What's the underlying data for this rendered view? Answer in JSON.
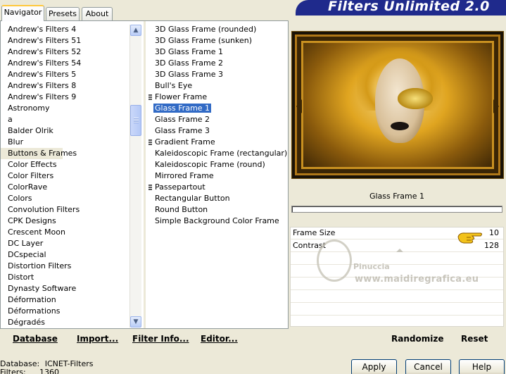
{
  "tabs": [
    {
      "label": "Navigator"
    },
    {
      "label": "Presets"
    },
    {
      "label": "About"
    }
  ],
  "banner": {
    "title": "Filters Unlimited 2.0",
    "color": "#1f2a8c"
  },
  "categories": [
    "Andrew's Filters 4",
    "Andrew's Filters 51",
    "Andrew's Filters 52",
    "Andrew's Filters 54",
    "Andrew's Filters 5",
    "Andrew's Filters 8",
    "Andrew's Filters 9",
    "Astronomy",
    "a",
    "Balder Olrik",
    "Blur",
    "Buttons & Frames",
    "Color Effects",
    "Color Filters",
    "ColorRave",
    "Colors",
    "Convolution Filters",
    "CPK Designs",
    "Crescent Moon",
    "DC Layer",
    "DCspecial",
    "Distortion Filters",
    "Distort",
    "Dynasty Software",
    "Déformation",
    "Déformations",
    "Dégradés"
  ],
  "selected_category": "Buttons & Frames",
  "filters": [
    {
      "label": "3D Glass Frame (rounded)",
      "mark": false
    },
    {
      "label": "3D Glass Frame (sunken)",
      "mark": false
    },
    {
      "label": "3D Glass Frame 1",
      "mark": false
    },
    {
      "label": "3D Glass Frame 2",
      "mark": false
    },
    {
      "label": "3D Glass Frame 3",
      "mark": false
    },
    {
      "label": "Bull's Eye",
      "mark": false
    },
    {
      "label": "Flower Frame",
      "mark": true
    },
    {
      "label": "Glass Frame 1",
      "mark": false
    },
    {
      "label": "Glass Frame 2",
      "mark": false
    },
    {
      "label": "Glass Frame 3",
      "mark": false
    },
    {
      "label": "Gradient Frame",
      "mark": true
    },
    {
      "label": "Kaleidoscopic Frame (rectangular)",
      "mark": false
    },
    {
      "label": "Kaleidoscopic Frame (round)",
      "mark": false
    },
    {
      "label": "Mirrored Frame",
      "mark": false
    },
    {
      "label": "Passepartout",
      "mark": true
    },
    {
      "label": "Rectangular Button",
      "mark": false
    },
    {
      "label": "Round Button",
      "mark": false
    },
    {
      "label": "Simple Background Color Frame",
      "mark": false
    }
  ],
  "selected_filter": "Glass Frame 1",
  "left_buttons": {
    "database": "Database",
    "import": "Import...",
    "filter_info": "Filter Info...",
    "editor": "Editor..."
  },
  "filter_name": "Glass Frame 1",
  "params": [
    {
      "label": "Frame Size",
      "value": "10"
    },
    {
      "label": "Contrast",
      "value": "128"
    }
  ],
  "watermark": {
    "line1": "Pinuccia",
    "line2": "www.maidiregrafica.eu"
  },
  "right_buttons": {
    "randomize": "Randomize",
    "reset": "Reset"
  },
  "status": {
    "database_label": "Database:",
    "database_value": "ICNET-Filters",
    "filters_label": "Filters:",
    "filters_value": "1360"
  },
  "dialog_buttons": {
    "apply": "Apply",
    "cancel": "Cancel",
    "help": "Help"
  }
}
